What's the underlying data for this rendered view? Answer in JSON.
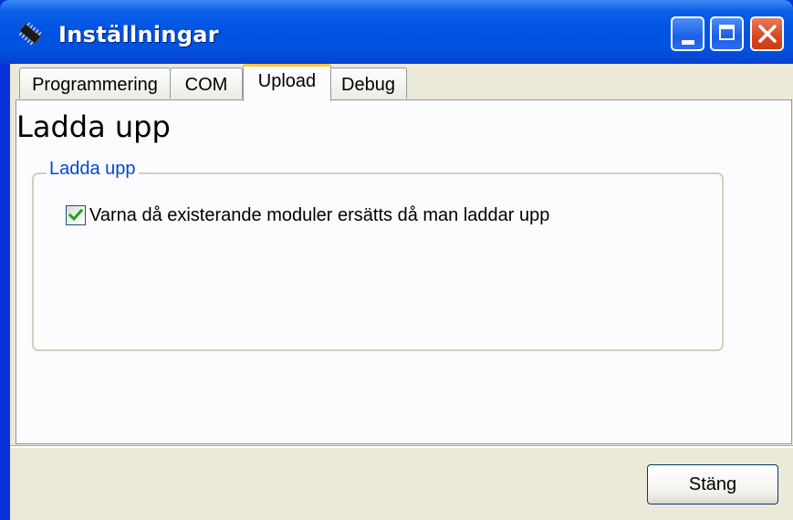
{
  "window": {
    "title": "Inställningar",
    "controls": [
      "minimize",
      "maximize",
      "close"
    ],
    "icons": {
      "app": "microchip-icon",
      "minimize": "minimize-icon",
      "maximize": "maximize-icon",
      "close": "close-icon"
    },
    "colors": {
      "titlebar": "#0054e3",
      "close_button": "#d8451f",
      "tab_active_accent": "#ffc73c",
      "group_label": "#0046d5",
      "checkmark": "#21a121"
    }
  },
  "tabs": [
    {
      "label": "Programmering",
      "active": false
    },
    {
      "label": "COM",
      "active": false
    },
    {
      "label": "Upload",
      "active": true
    },
    {
      "label": "Debug",
      "active": false
    }
  ],
  "panel": {
    "heading": "Ladda upp",
    "group": {
      "label": "Ladda upp",
      "checkbox": {
        "label": "Varna då existerande moduler ersätts då man laddar upp",
        "checked": true
      }
    }
  },
  "footer": {
    "close_label": "Stäng"
  }
}
